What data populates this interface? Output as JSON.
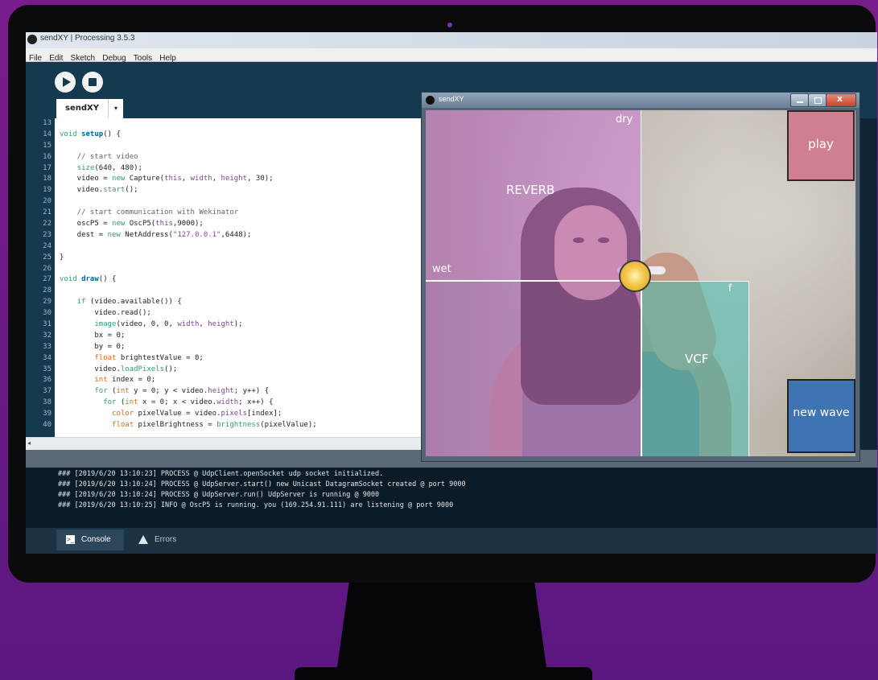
{
  "ide": {
    "title": "sendXY | Processing 3.5.3",
    "menu": [
      "File",
      "Edit",
      "Sketch",
      "Debug",
      "Tools",
      "Help"
    ],
    "tab_label": "sendXY",
    "tab_menu_glyph": "▾",
    "line_numbers": [
      "13",
      "14",
      "15",
      "16",
      "17",
      "18",
      "19",
      "20",
      "21",
      "22",
      "23",
      "24",
      "25",
      "26",
      "27",
      "28",
      "29",
      "30",
      "31",
      "32",
      "33",
      "34",
      "35",
      "36",
      "37",
      "38",
      "39",
      "40"
    ],
    "code": {
      "l14a": "void ",
      "l14b": "setup",
      "l14c": "() {",
      "l16": "    // start video",
      "l17a": "    ",
      "l17b": "size",
      "l17c": "(640, 480);",
      "l18a": "    video = ",
      "l18b": "new",
      "l18c": " Capture(",
      "l18d": "this",
      "l18e": ", ",
      "l18f": "width",
      "l18g": ", ",
      "l18h": "height",
      "l18i": ", 30);",
      "l19a": "    video.",
      "l19b": "start",
      "l19c": "();",
      "l21": "    // start communication with Wekinator",
      "l22a": "    oscP5 = ",
      "l22b": "new",
      "l22c": " OscP5(",
      "l22d": "this",
      "l22e": ",9000);",
      "l23a": "    dest = ",
      "l23b": "new",
      "l23c": " NetAddress(",
      "l23d": "\"127.0.0.1\"",
      "l23e": ",6448);",
      "l25": "}",
      "l27a": "void ",
      "l27b": "draw",
      "l27c": "() {",
      "l29a": "    ",
      "l29b": "if",
      "l29c": " (video.available()) {",
      "l30": "        video.read();",
      "l31a": "        ",
      "l31b": "image",
      "l31c": "(video, 0, 0, ",
      "l31d": "width",
      "l31e": ", ",
      "l31f": "height",
      "l31g": ");",
      "l32": "        bx = 0;",
      "l33": "        by = 0;",
      "l34a": "        ",
      "l34b": "float",
      "l34c": " brightestValue = 0;",
      "l35a": "        video.",
      "l35b": "loadPixels",
      "l35c": "();",
      "l36a": "        ",
      "l36b": "int",
      "l36c": " index = 0;",
      "l37a": "        ",
      "l37b": "for",
      "l37c": " (",
      "l37d": "int",
      "l37e": " y = 0; y < video.",
      "l37f": "height",
      "l37g": "; y++) {",
      "l38a": "          ",
      "l38b": "for",
      "l38c": " (",
      "l38d": "int",
      "l38e": " x = 0; x < video.",
      "l38f": "width",
      "l38g": "; x++) {",
      "l39a": "            ",
      "l39b": "color",
      "l39c": " pixelValue = video.",
      "l39d": "pixels",
      "l39e": "[index];",
      "l40a": "            ",
      "l40b": "float",
      "l40c": " pixelBrightness = ",
      "l40d": "brightness",
      "l40e": "(pixelValue);"
    },
    "console_lines": [
      "### [2019/6/20 13:10:23] PROCESS @ UdpClient.openSocket udp socket initialized.",
      "### [2019/6/20 13:10:24] PROCESS @ UdpServer.start() new Unicast DatagramSocket created @ port 9000",
      "### [2019/6/20 13:10:24] PROCESS @ UdpServer.run() UdpServer is running @ 9000",
      "### [2019/6/20 13:10:25] INFO @ OscP5 is running. you (169.254.91.111) are listening @ port 9000"
    ],
    "console_tab": "Console",
    "errors_tab": "Errors",
    "console_glyph": ">_",
    "scroll_left_glyph": "◂"
  },
  "sketch_window": {
    "title": "sendXY",
    "labels": {
      "dry": "dry",
      "reverb": "REVERB",
      "wet": "wet",
      "f": "f",
      "vcf": "VCF",
      "play": "play",
      "new_wave": "new wave"
    }
  },
  "colors": {
    "reverb_zone": "#cc78d6",
    "vcf_zone": "#46beaf",
    "play_button": "#cf7f8e",
    "new_wave_button": "#3f74b3",
    "tracker": "#f4c64a",
    "ide_dark": "#15394f"
  }
}
